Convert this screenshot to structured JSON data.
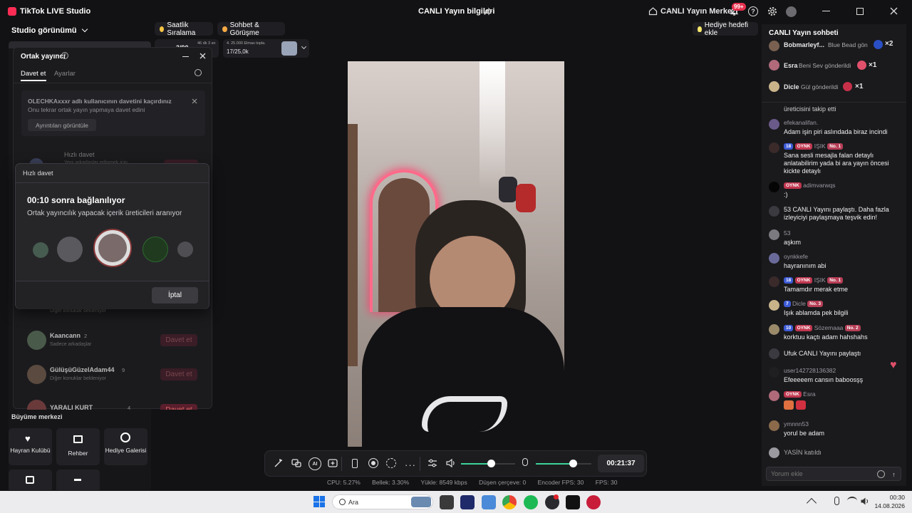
{
  "window": {
    "app_title": "TikTok LIVE Studio",
    "center_title": "CANLI Yayın bilgileri",
    "live_center": "CANLI Yayın Merkezi",
    "notif_count": "99+"
  },
  "toolbar": {
    "studio_view": "Studio görünümü",
    "hourly_rank": "Saatlik Sıralama",
    "chat_meet": "Sohbet & Görüşme",
    "gift_goal": "Hediye hedefi ekle",
    "rank_value": "3/90",
    "rank_sub": "46 dk 3 sn",
    "diamond_label": "4. 25.000 Elmas topla.",
    "diamond_progress": "17/25,0k"
  },
  "cohost": {
    "title": "Ortak yayıncı",
    "tabs": [
      "Davet et",
      "Ayarlar"
    ],
    "missed_title": "OLECHKAxxxr adlı kullanıcının davetini kaçırdınız",
    "missed_sub": "Onu tekrar ortak yayın yapmaya davet edini",
    "details_btn": "Ayrıntıları görüntüle",
    "quick_invite": "Hızlı davet",
    "quick_invite_sub": "Yeni arkadaşlar edinmek için",
    "waiting": "Diğer konuklar bekleniyor",
    "list": [
      {
        "name": "Kaancann",
        "count": "2",
        "sub": "Sadece arkadaşlar",
        "btn": "Davet et"
      },
      {
        "name": "GülüşüGüzelAdam44",
        "count": "9",
        "sub": "Diğer konuklar bekleniyor",
        "btn": "Davet et"
      },
      {
        "name": "YARALI KURT",
        "count": "4",
        "sub": "",
        "btn": "Davet et"
      }
    ]
  },
  "quick_dialog": {
    "header": "Hızlı davet",
    "countdown": "00:10 sonra bağlanılıyor",
    "searching": "Ortak yayıncılık yapacak içerik üreticileri aranıyor",
    "cancel": "İptal"
  },
  "growth": {
    "title": "Büyüme merkezi",
    "items": [
      "Hayran Kulübü",
      "Rehber",
      "Hediye Galerisi"
    ]
  },
  "controls": {
    "timer": "00:21:37"
  },
  "stats": {
    "cpu": "CPU: 5.27%",
    "mem": "Bellek: 3.30%",
    "upload": "Yükle: 8549 kbps",
    "dropped": "Düşen çerçeve: 0",
    "encoder": "Encoder FPS: 30",
    "fps": "FPS: 30"
  },
  "chat": {
    "title": "CANLI Yayın sohbeti",
    "gifts": [
      {
        "name": "Bobmarleyf...",
        "text": "Blue Bead gön",
        "mult": "×2"
      },
      {
        "name": "Esra",
        "text": "Beni Sev gönderildi",
        "mult": "×1"
      },
      {
        "name": "Dicle",
        "text": "Gül gönderildi",
        "mult": "×1"
      }
    ],
    "m0": "üreticisini takip etti",
    "m1n": "efekanalifan.",
    "m1": "Adam işin piri aslındada biraz incindi",
    "m2n": "IŞIK",
    "m2": "Sana sesli mesajla falan detaylı anlatabilirim yada bi ara yayın öncesi kickte detaylı",
    "m3n": "adimvarwqs",
    "m3": ":)",
    "m4": "53  CANLI Yayını paylaştı. Daha fazla izleyiciyi paylaşmaya teşvik edin!",
    "m5n": "53",
    "m5": "aşkım",
    "m6n": "oynkkefe",
    "m6": "hayranınım abi",
    "m7n": "IŞIK",
    "m7": "Tamamdır merak etme",
    "m8n": "Dicle",
    "m8": "Işık ablamda pek bilgili",
    "m9n": "Sözemaaa",
    "m9": "korktuu kaçtı adam hahshahs",
    "m10": "Ufuk  CANLI Yayını paylaştı",
    "m11n": "user142728136382",
    "m11": "Efeeeeem cansın baboosşş",
    "m12n": "Esra",
    "m13n": "ymnnn53",
    "m13": "yorul be adam",
    "m14": "YASİN  katıldı",
    "b_18": "18",
    "b_oynk": "OYNK",
    "b_no1": "No. 1",
    "b_7": "7",
    "b_no3": "No. 3",
    "b_10": "10",
    "b_no2": "No. 2",
    "input_placeholder": "Yorum ekle"
  },
  "taskbar": {
    "search": "Ara",
    "time": "00:30",
    "date": "14.08.2026"
  }
}
